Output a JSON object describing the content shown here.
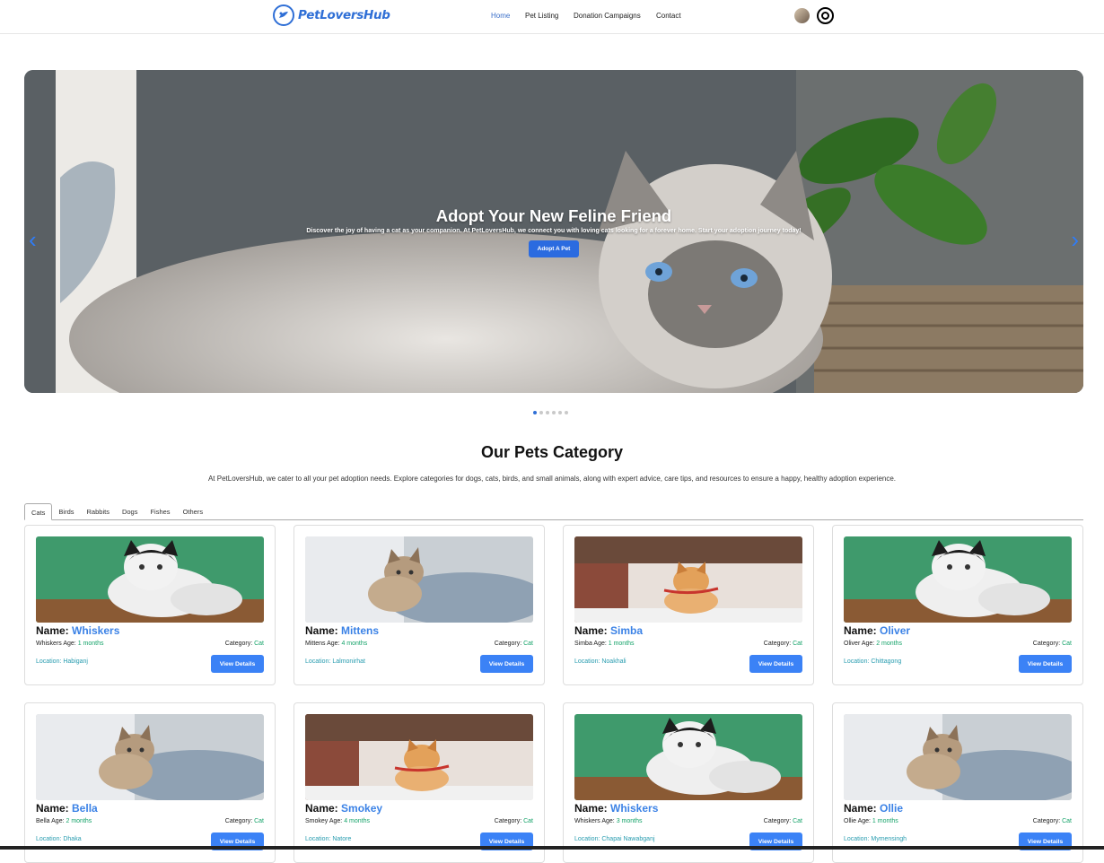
{
  "brand": {
    "name": "PetLoversHub"
  },
  "nav": [
    {
      "label": "Home"
    },
    {
      "label": "Pet Listing"
    },
    {
      "label": "Donation Campaigns"
    },
    {
      "label": "Contact"
    }
  ],
  "hero": {
    "title": "Adopt Your New Feline Friend",
    "subtitle": "Discover the joy of having a cat as your companion. At PetLoversHub, we connect you with loving cats looking for a forever home. Start your adoption journey today!",
    "button": "Adopt A Pet",
    "prev": "‹",
    "next": "›"
  },
  "section": {
    "title": "Our Pets Category",
    "description": "At PetLoversHub, we cater to all your pet adoption needs. Explore categories for dogs, cats, birds, and small animals, along with expert advice, care tips, and resources to ensure a happy, healthy adoption experience."
  },
  "tabs": [
    {
      "label": "Cats"
    },
    {
      "label": "Birds"
    },
    {
      "label": "Rabbits"
    },
    {
      "label": "Dogs"
    },
    {
      "label": "Fishes"
    },
    {
      "label": "Others"
    }
  ],
  "common": {
    "name_label": "Name: ",
    "age_suffix": " Age: ",
    "category_label": "Category: ",
    "location_label": "Location: ",
    "button": "View Details"
  },
  "pets": [
    {
      "name": "Whiskers",
      "age": "1 months",
      "category": "Cat",
      "location": "Habiganj",
      "image": "tuxedo-cat"
    },
    {
      "name": "Mittens",
      "age": "4 months",
      "category": "Cat",
      "location": "Lalmonirhat",
      "image": "tabby-kitten-sofa"
    },
    {
      "name": "Simba",
      "age": "1 months",
      "category": "Cat",
      "location": "Noakhali",
      "image": "orange-kitten"
    },
    {
      "name": "Oliver",
      "age": "2 months",
      "category": "Cat",
      "location": "Chittagong",
      "image": "tuxedo-cat"
    },
    {
      "name": "Bella",
      "age": "2 months",
      "category": "Cat",
      "location": "Dhaka",
      "image": "tabby-kitten-sofa"
    },
    {
      "name": "Smokey",
      "age": "4 months",
      "category": "Cat",
      "location": "Natore",
      "image": "orange-kitten"
    },
    {
      "name": "Whiskers",
      "age": "3 months",
      "category": "Cat",
      "location": "Chapai Nawabganj",
      "image": "tuxedo-cat"
    },
    {
      "name": "Ollie",
      "age": "1 months",
      "category": "Cat",
      "location": "Mymensingh",
      "image": "tabby-kitten-sofa"
    }
  ]
}
